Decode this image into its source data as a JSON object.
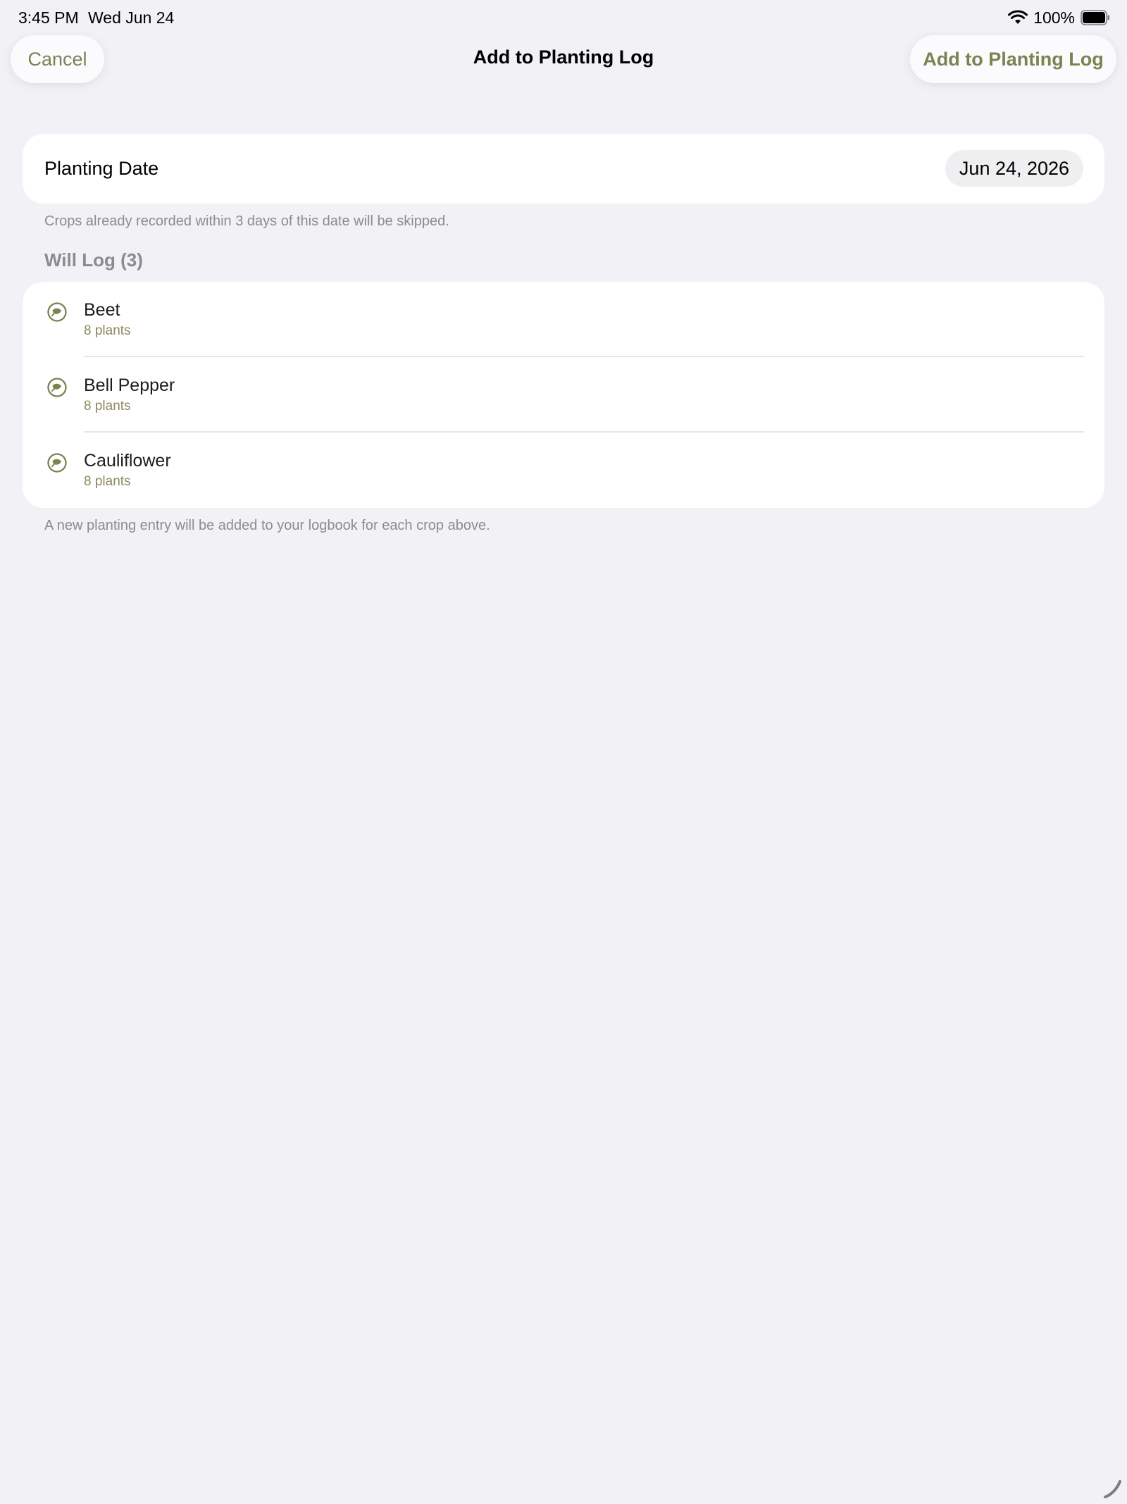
{
  "status_bar": {
    "time": "3:45 PM",
    "date": "Wed Jun 24",
    "battery": "100%"
  },
  "nav": {
    "cancel_label": "Cancel",
    "title": "Add to Planting Log",
    "confirm_label": "Add to Planting Log"
  },
  "planting_date": {
    "label": "Planting Date",
    "value": "Jun 24, 2026",
    "note": "Crops already recorded within 3 days of this date will be skipped."
  },
  "will_log": {
    "header": "Will Log (3)",
    "items": [
      {
        "name": "Beet",
        "count": "8 plants",
        "icon": "leaf-icon"
      },
      {
        "name": "Bell Pepper",
        "count": "8 plants",
        "icon": "leaf-icon"
      },
      {
        "name": "Cauliflower",
        "count": "8 plants",
        "icon": "leaf-icon"
      }
    ],
    "note": "A new planting entry will be added to your logbook for each crop above."
  },
  "colors": {
    "background": "#f1f1f6",
    "accent": "#7a8351",
    "secondary_text": "#8b8b91",
    "count_text": "#8d8860"
  }
}
